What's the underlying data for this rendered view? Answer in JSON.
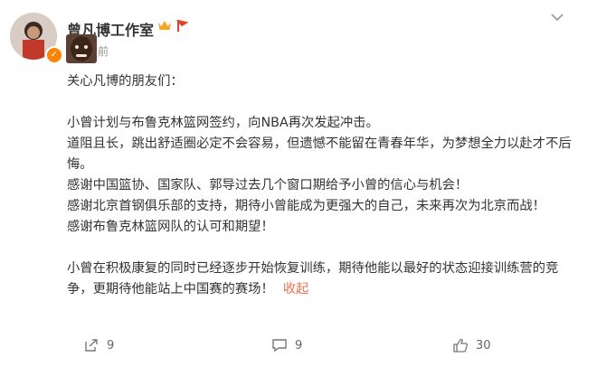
{
  "author": {
    "name": "曾凡博工作室",
    "time_suffix": "前"
  },
  "post": {
    "paragraphs": [
      "关心凡博的朋友们：",
      "",
      "小曾计划与布鲁克林篮网签约，向NBA再次发起冲击。",
      "道阻且长，跳出舒适圈必定不会容易，但遗憾不能留在青春年华，为梦想全力以赴才不后悔。",
      "感谢中国篮协、国家队、郭导过去几个窗口期给予小曾的信心与机会！",
      "感谢北京首钢俱乐部的支持，期待小曾能成为更强大的自己，未来再次为北京而战！",
      "感谢布鲁克林篮网队的认可和期望！",
      "",
      "小曾在积极康复的同时已经逐步开始恢复训练，期待他能以最好的状态迎接训练营的竞争，更期待他能站上中国赛的赛场！"
    ],
    "collapse_label": "收起"
  },
  "actions": {
    "repost_count": "9",
    "comment_count": "9",
    "like_count": "30"
  },
  "colors": {
    "accent": "#eb7350",
    "verified": "#ff8200",
    "muted": "#939393"
  },
  "icons": [
    "verified-icon",
    "crown-icon",
    "flag-icon",
    "more-menu-icon",
    "repost-icon",
    "comment-icon",
    "like-icon"
  ]
}
